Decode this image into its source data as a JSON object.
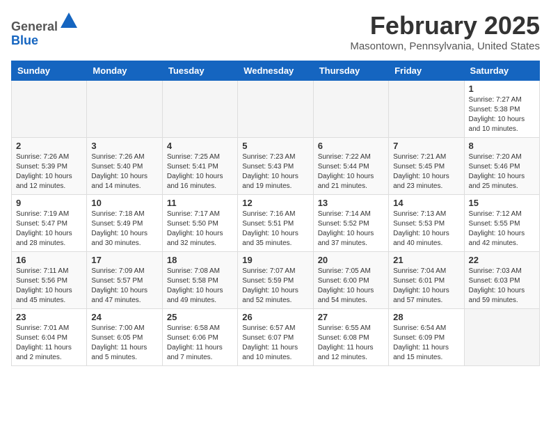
{
  "header": {
    "logo_general": "General",
    "logo_blue": "Blue",
    "month_title": "February 2025",
    "location": "Masontown, Pennsylvania, United States"
  },
  "days_of_week": [
    "Sunday",
    "Monday",
    "Tuesday",
    "Wednesday",
    "Thursday",
    "Friday",
    "Saturday"
  ],
  "weeks": [
    [
      {
        "day": "",
        "info": ""
      },
      {
        "day": "",
        "info": ""
      },
      {
        "day": "",
        "info": ""
      },
      {
        "day": "",
        "info": ""
      },
      {
        "day": "",
        "info": ""
      },
      {
        "day": "",
        "info": ""
      },
      {
        "day": "1",
        "info": "Sunrise: 7:27 AM\nSunset: 5:38 PM\nDaylight: 10 hours and 10 minutes."
      }
    ],
    [
      {
        "day": "2",
        "info": "Sunrise: 7:26 AM\nSunset: 5:39 PM\nDaylight: 10 hours and 12 minutes."
      },
      {
        "day": "3",
        "info": "Sunrise: 7:26 AM\nSunset: 5:40 PM\nDaylight: 10 hours and 14 minutes."
      },
      {
        "day": "4",
        "info": "Sunrise: 7:25 AM\nSunset: 5:41 PM\nDaylight: 10 hours and 16 minutes."
      },
      {
        "day": "5",
        "info": "Sunrise: 7:23 AM\nSunset: 5:43 PM\nDaylight: 10 hours and 19 minutes."
      },
      {
        "day": "6",
        "info": "Sunrise: 7:22 AM\nSunset: 5:44 PM\nDaylight: 10 hours and 21 minutes."
      },
      {
        "day": "7",
        "info": "Sunrise: 7:21 AM\nSunset: 5:45 PM\nDaylight: 10 hours and 23 minutes."
      },
      {
        "day": "8",
        "info": "Sunrise: 7:20 AM\nSunset: 5:46 PM\nDaylight: 10 hours and 25 minutes."
      }
    ],
    [
      {
        "day": "9",
        "info": "Sunrise: 7:19 AM\nSunset: 5:47 PM\nDaylight: 10 hours and 28 minutes."
      },
      {
        "day": "10",
        "info": "Sunrise: 7:18 AM\nSunset: 5:49 PM\nDaylight: 10 hours and 30 minutes."
      },
      {
        "day": "11",
        "info": "Sunrise: 7:17 AM\nSunset: 5:50 PM\nDaylight: 10 hours and 32 minutes."
      },
      {
        "day": "12",
        "info": "Sunrise: 7:16 AM\nSunset: 5:51 PM\nDaylight: 10 hours and 35 minutes."
      },
      {
        "day": "13",
        "info": "Sunrise: 7:14 AM\nSunset: 5:52 PM\nDaylight: 10 hours and 37 minutes."
      },
      {
        "day": "14",
        "info": "Sunrise: 7:13 AM\nSunset: 5:53 PM\nDaylight: 10 hours and 40 minutes."
      },
      {
        "day": "15",
        "info": "Sunrise: 7:12 AM\nSunset: 5:55 PM\nDaylight: 10 hours and 42 minutes."
      }
    ],
    [
      {
        "day": "16",
        "info": "Sunrise: 7:11 AM\nSunset: 5:56 PM\nDaylight: 10 hours and 45 minutes."
      },
      {
        "day": "17",
        "info": "Sunrise: 7:09 AM\nSunset: 5:57 PM\nDaylight: 10 hours and 47 minutes."
      },
      {
        "day": "18",
        "info": "Sunrise: 7:08 AM\nSunset: 5:58 PM\nDaylight: 10 hours and 49 minutes."
      },
      {
        "day": "19",
        "info": "Sunrise: 7:07 AM\nSunset: 5:59 PM\nDaylight: 10 hours and 52 minutes."
      },
      {
        "day": "20",
        "info": "Sunrise: 7:05 AM\nSunset: 6:00 PM\nDaylight: 10 hours and 54 minutes."
      },
      {
        "day": "21",
        "info": "Sunrise: 7:04 AM\nSunset: 6:01 PM\nDaylight: 10 hours and 57 minutes."
      },
      {
        "day": "22",
        "info": "Sunrise: 7:03 AM\nSunset: 6:03 PM\nDaylight: 10 hours and 59 minutes."
      }
    ],
    [
      {
        "day": "23",
        "info": "Sunrise: 7:01 AM\nSunset: 6:04 PM\nDaylight: 11 hours and 2 minutes."
      },
      {
        "day": "24",
        "info": "Sunrise: 7:00 AM\nSunset: 6:05 PM\nDaylight: 11 hours and 5 minutes."
      },
      {
        "day": "25",
        "info": "Sunrise: 6:58 AM\nSunset: 6:06 PM\nDaylight: 11 hours and 7 minutes."
      },
      {
        "day": "26",
        "info": "Sunrise: 6:57 AM\nSunset: 6:07 PM\nDaylight: 11 hours and 10 minutes."
      },
      {
        "day": "27",
        "info": "Sunrise: 6:55 AM\nSunset: 6:08 PM\nDaylight: 11 hours and 12 minutes."
      },
      {
        "day": "28",
        "info": "Sunrise: 6:54 AM\nSunset: 6:09 PM\nDaylight: 11 hours and 15 minutes."
      },
      {
        "day": "",
        "info": ""
      }
    ]
  ]
}
